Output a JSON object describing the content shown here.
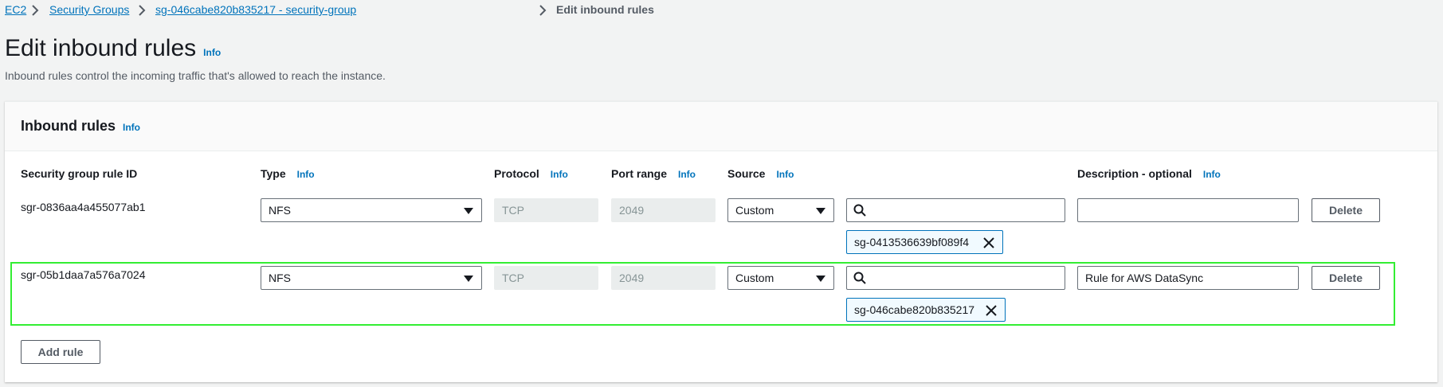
{
  "breadcrumb": {
    "items": [
      "EC2",
      "Security Groups",
      "sg-046cabe820b835217 - security-group"
    ],
    "current": "Edit inbound rules"
  },
  "page": {
    "title": "Edit inbound rules",
    "info": "Info",
    "description": "Inbound rules control the incoming traffic that's allowed to reach the instance."
  },
  "panel": {
    "title": "Inbound rules",
    "info": "Info",
    "columns": {
      "rule_id": "Security group rule ID",
      "type": "Type",
      "protocol": "Protocol",
      "port_range": "Port range",
      "source": "Source",
      "description": "Description - optional",
      "info": "Info"
    },
    "rules": [
      {
        "rule_id": "sgr-0836aa4a455077ab1",
        "type": "NFS",
        "protocol": "TCP",
        "port_range": "2049",
        "source_mode": "Custom",
        "search_value": "",
        "token": "sg-0413536639bf089f4",
        "description": "",
        "delete_label": "Delete"
      },
      {
        "rule_id": "sgr-05b1daa7a576a7024",
        "type": "NFS",
        "protocol": "TCP",
        "port_range": "2049",
        "source_mode": "Custom",
        "search_value": "",
        "token": "sg-046cabe820b835217",
        "description": "Rule for AWS DataSync",
        "delete_label": "Delete"
      }
    ],
    "add_rule_label": "Add rule"
  },
  "colors": {
    "link": "#0073bb",
    "highlight": "#33ee33",
    "token_border": "#0073bb"
  }
}
